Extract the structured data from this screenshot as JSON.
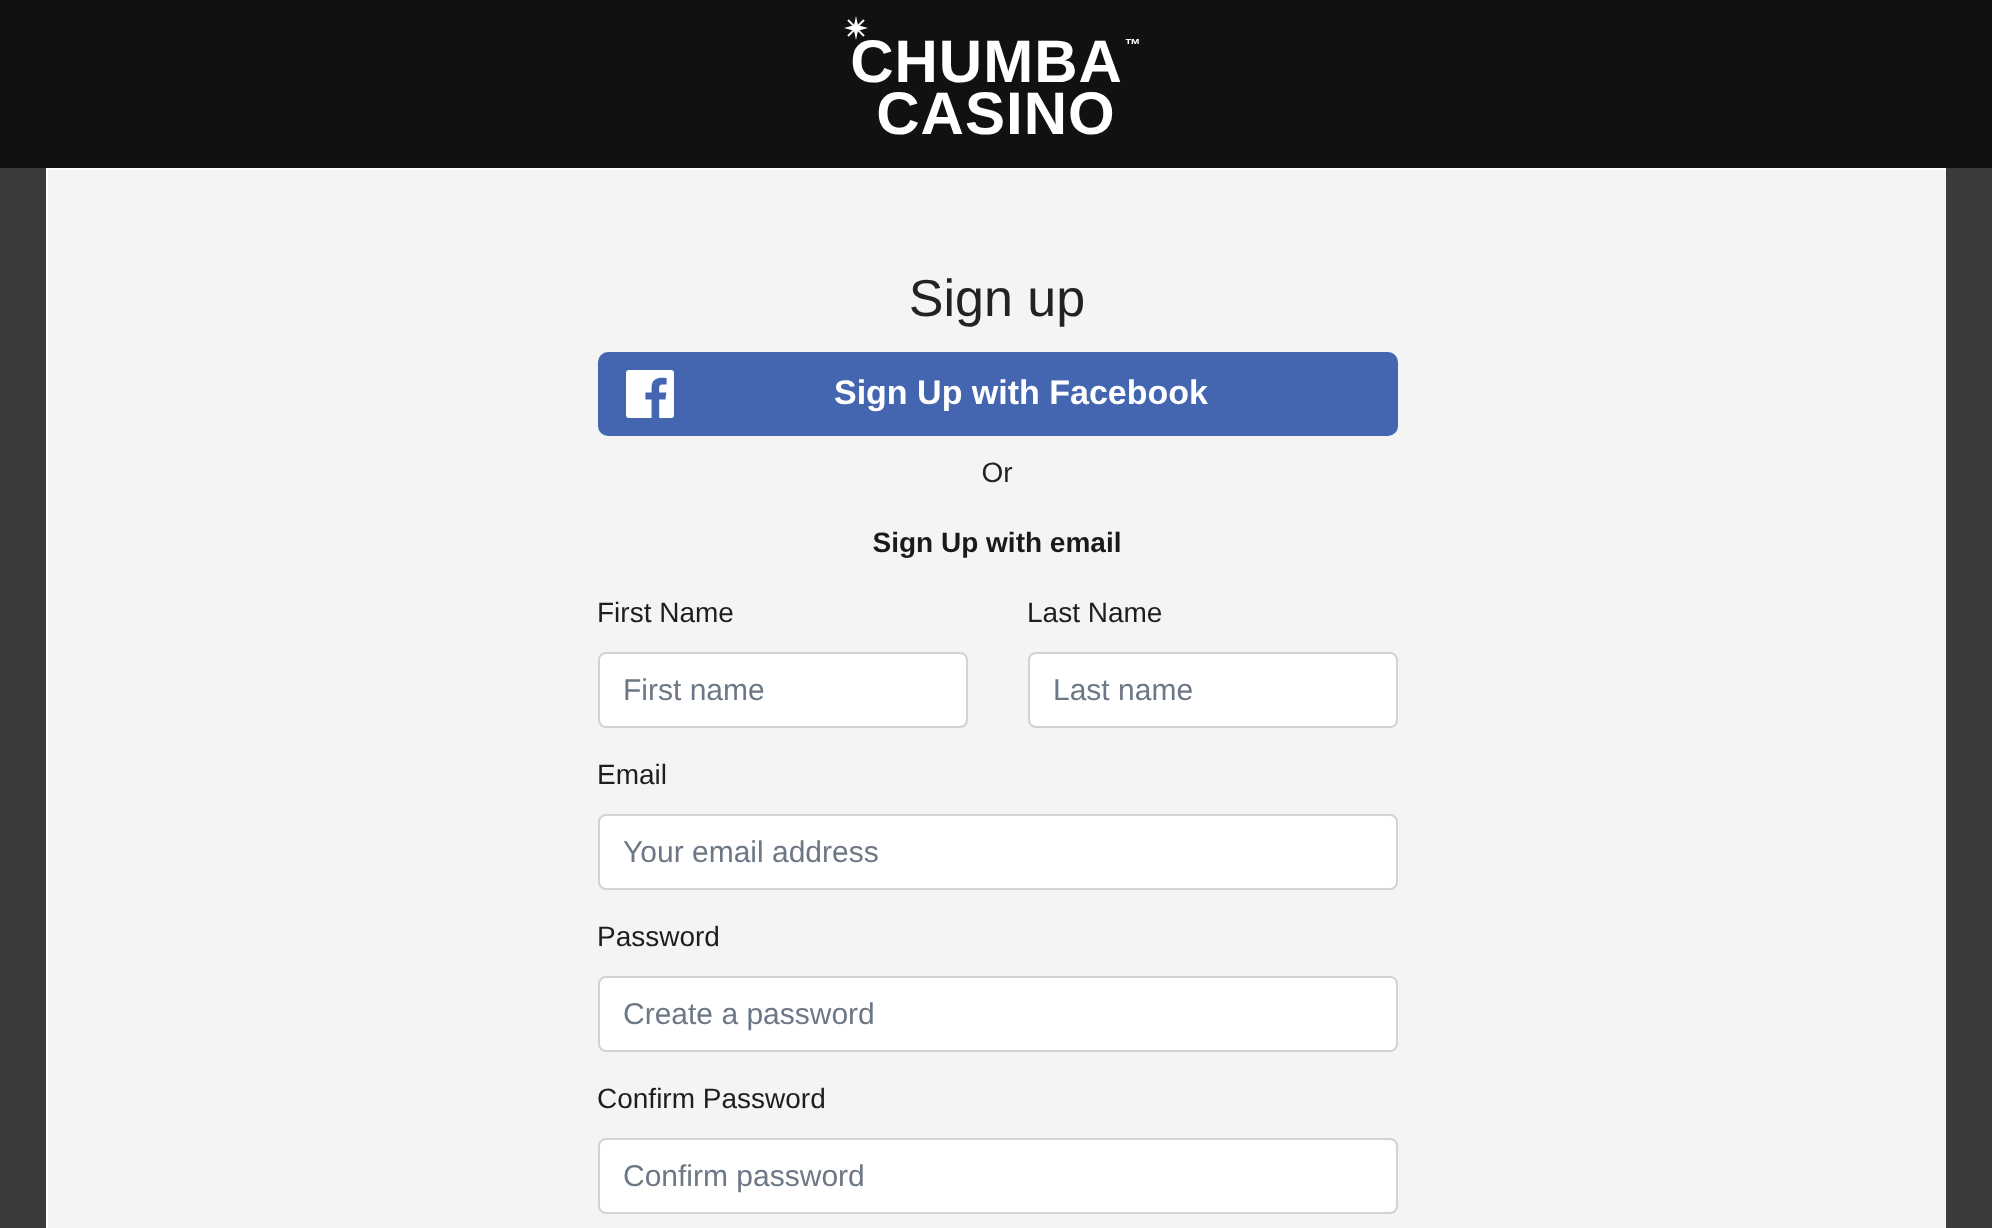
{
  "header": {
    "logo": [
      "CHUMBA$^{™}$",
      "CASINO"
    ]
  },
  "signup": {
    "title": "Sign up",
    "facebook_button": {
      "label": "Sign Up with Facebook"
    },
    "divider": "Or",
    "email_heading": "Sign Up with email",
    "field_rows": [
      {
        "fields": [
          {
            "label": "First Name",
            "placeholder": "First name"
          },
          {
            "label": "Last Name",
            "placeholder": "Last name"
          }
        ]
      },
      {
        "fields": [
          {
            "label": "Email",
            "placeholder": "Your email address"
          }
        ]
      },
      {
        "fields": [
          {
            "label": "Password",
            "placeholder": "Create a password"
          }
        ]
      },
      {
        "fields": [
          {
            "label": "Confirm Password",
            "placeholder": "Confirm password"
          }
        ]
      }
    ]
  }
}
